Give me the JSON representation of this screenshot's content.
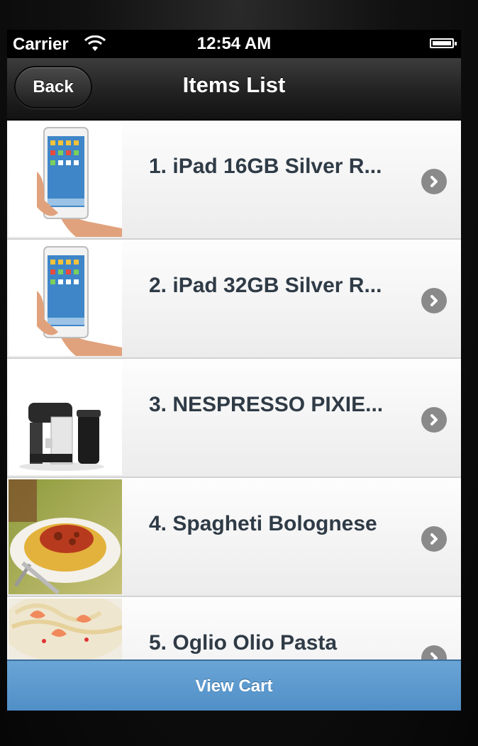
{
  "status_bar": {
    "carrier": "Carrier",
    "time": "12:54 AM"
  },
  "navbar": {
    "back_label": "Back",
    "title": "Items List"
  },
  "items": [
    {
      "label": "1. iPad 16GB Silver R...",
      "image": "ipad-image"
    },
    {
      "label": "2. iPad 32GB Silver R...",
      "image": "ipad-image"
    },
    {
      "label": "3. NESPRESSO PIXIE...",
      "image": "espresso-machine-image"
    },
    {
      "label": "4. Spagheti Bolognese",
      "image": "spaghetti-bolognese-image"
    },
    {
      "label": "5. Oglio Olio Pasta",
      "image": "shrimp-pasta-image"
    }
  ],
  "footer": {
    "view_cart_label": "View Cart"
  },
  "colors": {
    "navbar": "#242424",
    "footer_accent": "#5b9bd1",
    "item_text": "#2f3b46",
    "disclosure": "#8a8a8a"
  }
}
